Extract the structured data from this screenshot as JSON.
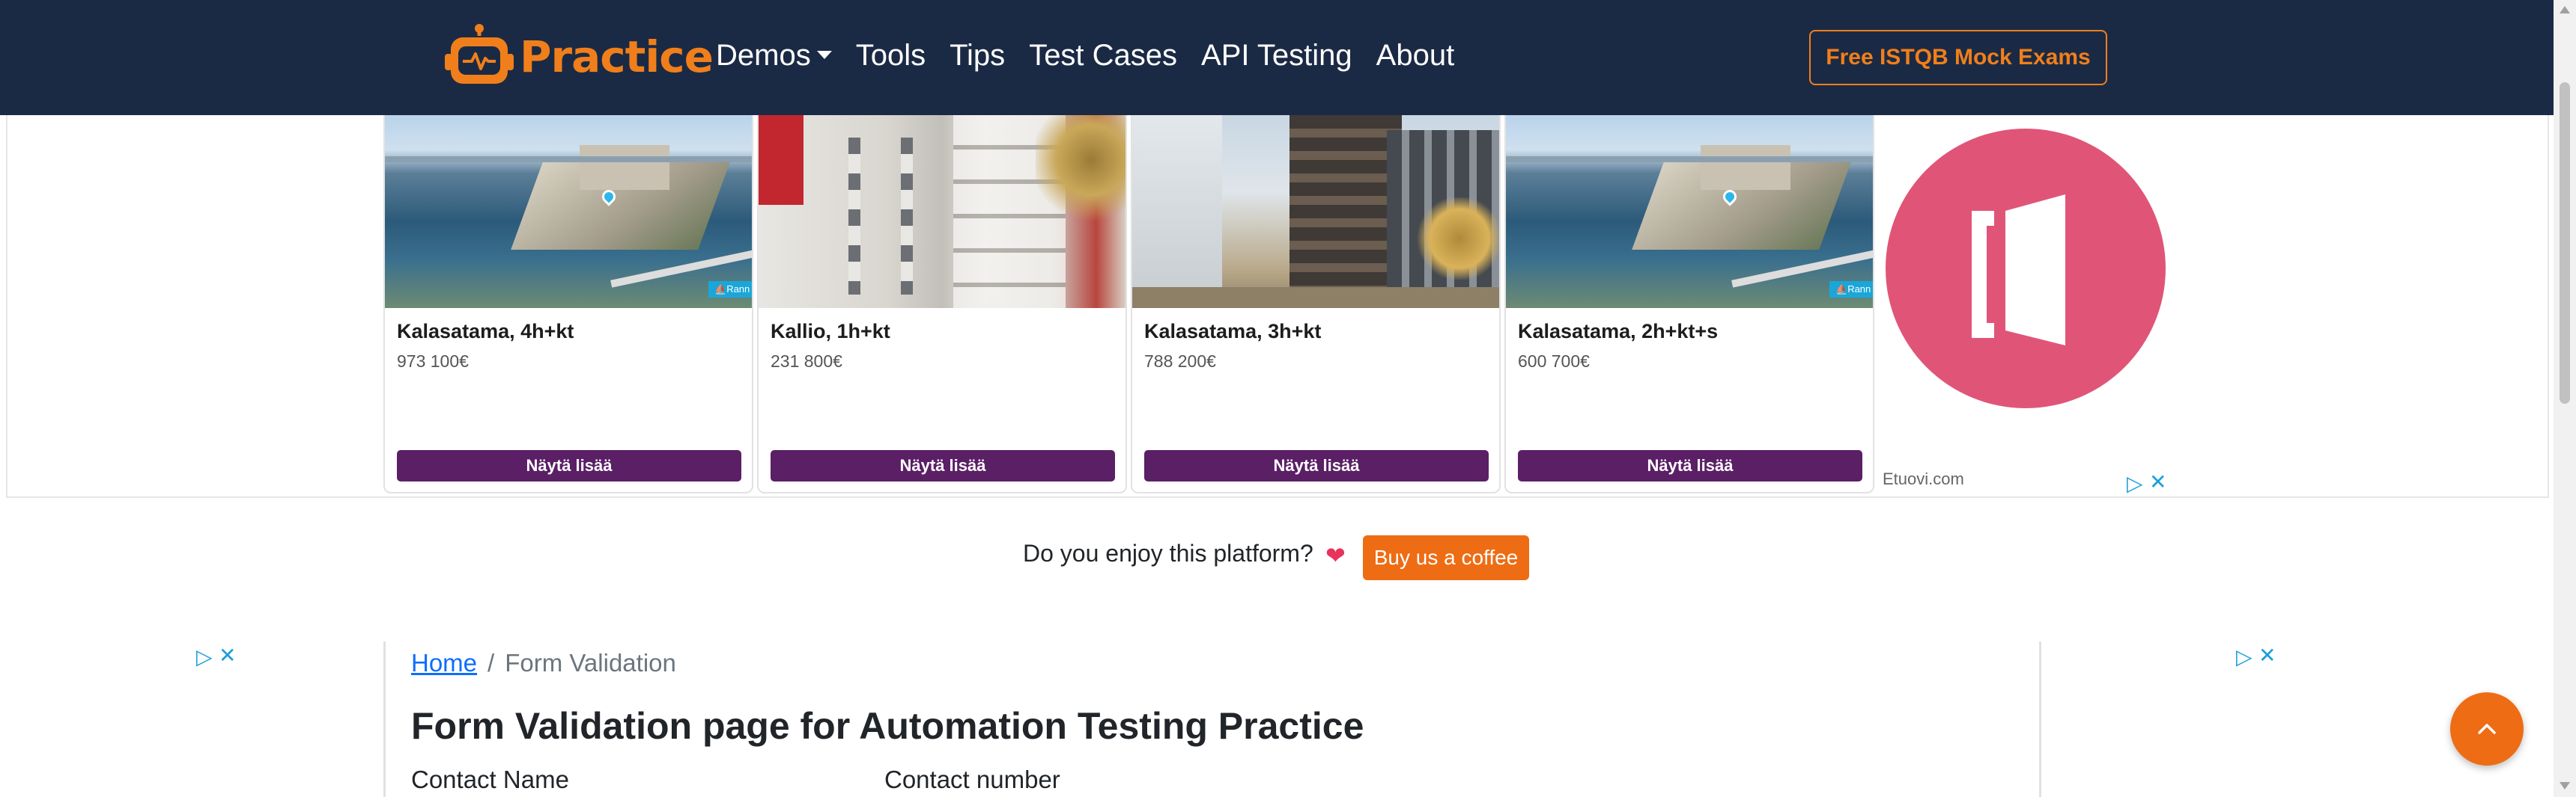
{
  "navbar": {
    "brand": "Practice",
    "links": [
      "Demos",
      "Tools",
      "Tips",
      "Test Cases",
      "API Testing",
      "About"
    ],
    "cta": "Free ISTQB Mock Exams"
  },
  "ad": {
    "listings": [
      {
        "title": "Kalasatama, 4h+kt",
        "price": "973 100€",
        "button": "Näytä lisää",
        "tag": "Rann"
      },
      {
        "title": "Kallio, 1h+kt",
        "price": "231 800€",
        "button": "Näytä lisää"
      },
      {
        "title": "Kalasatama, 3h+kt",
        "price": "788 200€",
        "button": "Näytä lisää"
      },
      {
        "title": "Kalasatama, 2h+kt+s",
        "price": "600 700€",
        "button": "Näytä lisää",
        "tag": "Rann"
      }
    ],
    "advertiser": "Etuovi.com"
  },
  "support": {
    "text": "Do you enjoy this platform?",
    "button": "Buy us a coffee"
  },
  "breadcrumb": {
    "home": "Home",
    "separator": "/",
    "current": "Form Validation"
  },
  "page": {
    "title": "Form Validation page for Automation Testing Practice",
    "label_contact_name": "Contact Name",
    "label_contact_number": "Contact number"
  },
  "colors": {
    "navbar_bg": "#1b2a44",
    "brand_orange": "#f07f1b",
    "ad_button": "#5b1f66",
    "etuovi_pink": "#e05577",
    "coffee_button": "#ee6c13",
    "link_blue": "#0d6efd"
  }
}
